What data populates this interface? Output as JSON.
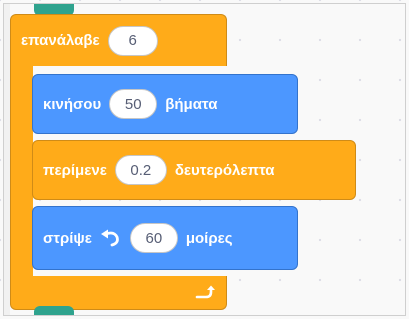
{
  "repeat_block": {
    "label": "επανάλαβε",
    "count": "6"
  },
  "move_block": {
    "label": "κινήσου",
    "steps": "50",
    "unit": "βήματα"
  },
  "wait_block": {
    "label": "περίμενε",
    "seconds": "0.2",
    "unit": "δευτερόλεπτα"
  },
  "turn_block": {
    "label": "στρίψε",
    "icon": "rotate-left-icon",
    "degrees": "60",
    "unit": "μοίρες"
  },
  "colors": {
    "control": "#ffab19",
    "motion": "#4c97ff",
    "hat_tab": "#2fa38e"
  }
}
